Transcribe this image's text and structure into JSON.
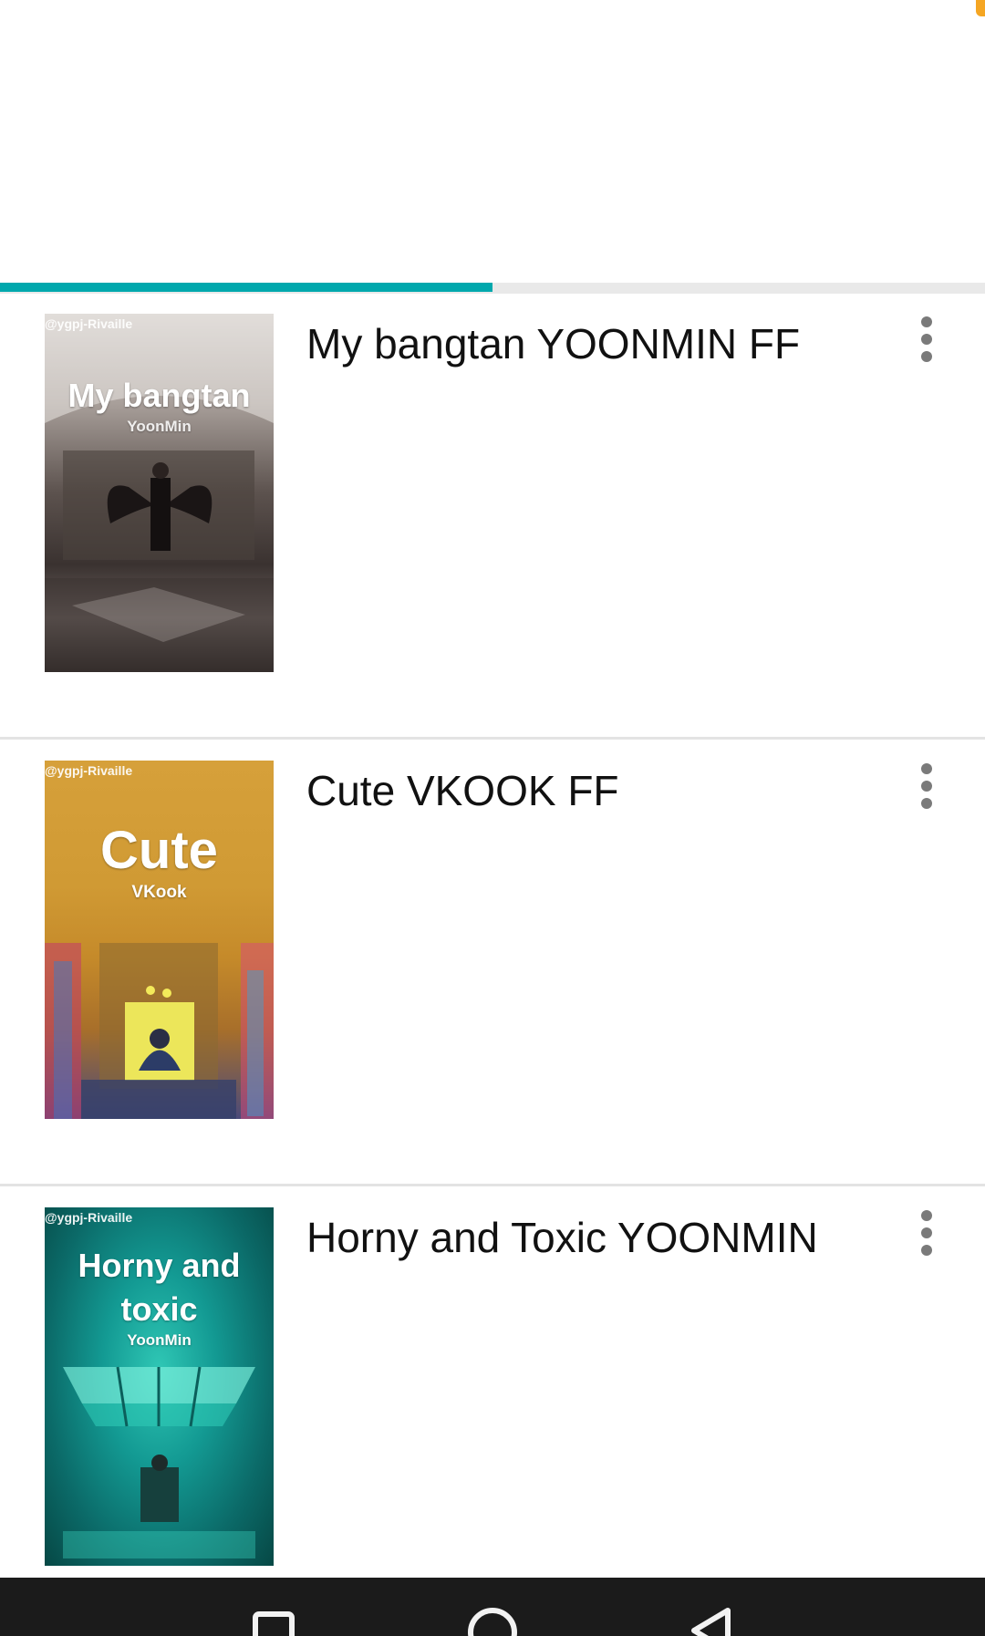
{
  "colors": {
    "accent": "#00a8ad",
    "divider": "#e3e3e3",
    "title_text": "#111111",
    "nav_bar": "#1b1b1b",
    "orange_badge": "#f5a623"
  },
  "tabs": {
    "active_indicator_fraction": 0.5
  },
  "stories": [
    {
      "title": "My bangtan YOONMIN FF",
      "cover": {
        "watermark": "@ygpj-Rivaille",
        "title_line1": "My bangtan",
        "title_line2": "",
        "subtitle": "YoonMin",
        "palette": [
          "#cfc9c6",
          "#6e6460",
          "#2d2624",
          "#8f8682"
        ]
      },
      "menu_icon": "more-vert-icon"
    },
    {
      "title": "Cute VKOOK FF",
      "cover": {
        "watermark": "@ygpj-Rivaille",
        "title_line1": "Cute",
        "title_line2": "",
        "subtitle": "VKook",
        "palette": [
          "#d9a23a",
          "#c98a2c",
          "#b8782a",
          "#e3d44a"
        ]
      },
      "menu_icon": "more-vert-icon"
    },
    {
      "title": "Horny and Toxic YOONMIN",
      "cover": {
        "watermark": "@ygpj-Rivaille",
        "title_line1": "Horny and",
        "title_line2": "toxic",
        "subtitle": "YoonMin",
        "palette": [
          "#0f8d8a",
          "#15b3a6",
          "#0c5f5c",
          "#27d3c2"
        ]
      },
      "menu_icon": "more-vert-icon"
    }
  ],
  "navigation": {
    "buttons": [
      {
        "name": "recent-apps-button",
        "icon": "square-icon"
      },
      {
        "name": "home-button",
        "icon": "circle-icon"
      },
      {
        "name": "back-button",
        "icon": "triangle-icon"
      }
    ]
  }
}
